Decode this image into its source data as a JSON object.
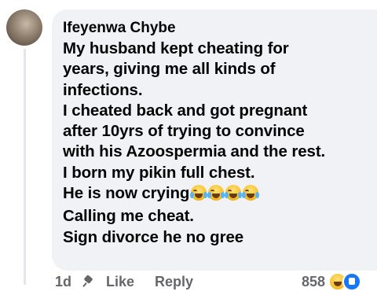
{
  "comment": {
    "author": "Ifeyenwa Chybe",
    "lines": [
      "My husband kept cheating for",
      "years, giving me all kinds of",
      "infections.",
      "I cheated back and got pregnant",
      "after 10yrs of trying to convince",
      "with his Azoospermia and the rest.",
      "I born my pikin full chest.",
      "He is now crying",
      "Calling me cheat.",
      "Sign divorce he no gree"
    ],
    "inline_emoji": [
      "loudly-crying-face-icon",
      "loudly-crying-face-icon",
      "loudly-crying-face-icon",
      "loudly-crying-face-icon"
    ]
  },
  "actions": {
    "time": "1d",
    "like_label": "Like",
    "reply_label": "Reply"
  },
  "reactions": {
    "count": "858",
    "icons": [
      "haha-icon",
      "like-icon"
    ]
  },
  "colors": {
    "bubble_bg": "#f0f2f5",
    "text": "#050505",
    "secondary_text": "#65676b",
    "like_blue": "#1877f2"
  }
}
